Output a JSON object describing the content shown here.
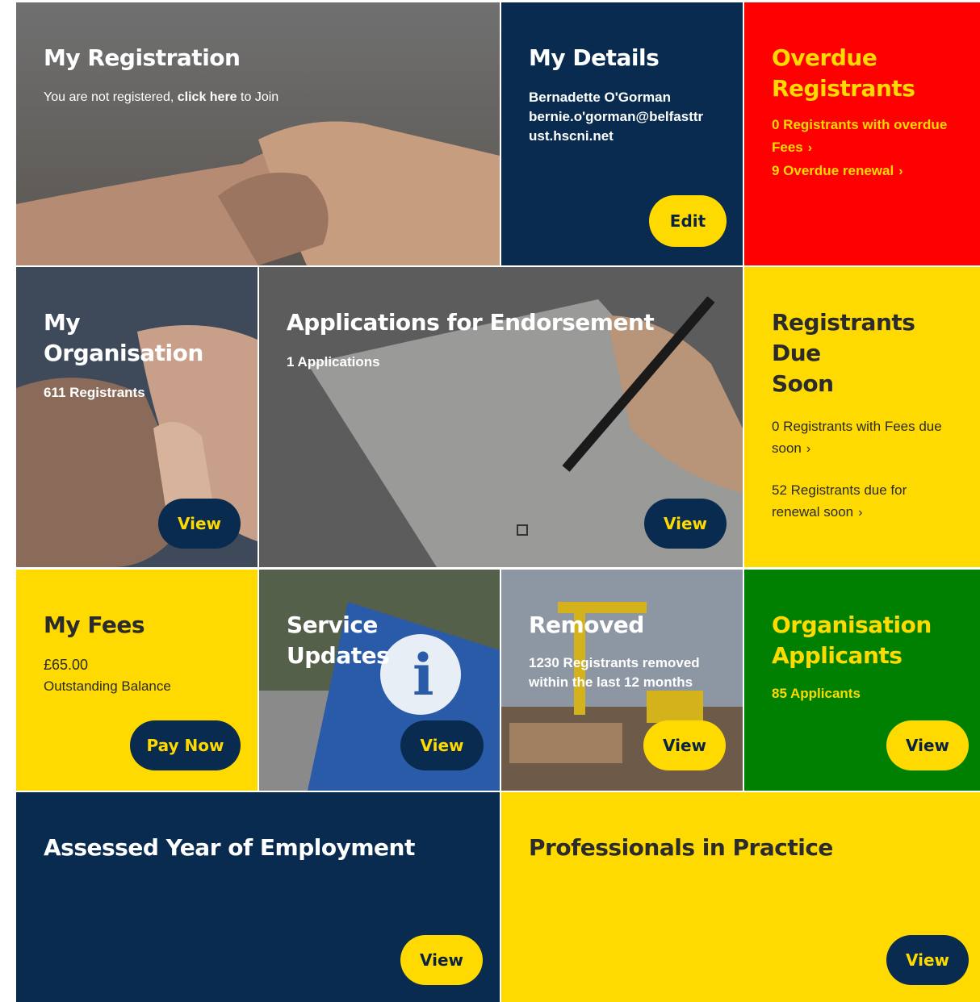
{
  "colors": {
    "navy": "#082b4f",
    "yellow": "#FFDA00",
    "red": "#FF0000",
    "green": "#008000"
  },
  "my_registration": {
    "title": "My Registration",
    "text_prefix": "You are not registered, ",
    "link": "click here",
    "text_suffix": " to Join"
  },
  "my_details": {
    "title": "My Details",
    "name": "Bernadette O'Gorman",
    "email_line1": "bernie.o'gorman@belfasttr",
    "email_line2": "ust.hscni.net",
    "button": "Edit"
  },
  "overdue": {
    "title_line1": "Overdue",
    "title_line2": "Registrants",
    "fees_line1": "0 Registrants with overdue",
    "fees_line2": "Fees",
    "renewal": "9 Overdue renewal"
  },
  "my_organisation": {
    "title": "My Organisation",
    "count": "611 Registrants",
    "button": "View"
  },
  "endorsement": {
    "title": "Applications for Endorsement",
    "count": "1 Applications",
    "button": "View"
  },
  "due_soon": {
    "title_line1": "Registrants Due",
    "title_line2": "Soon",
    "fees_line1": "0 Registrants with Fees due",
    "fees_line2": "soon",
    "renewal_line1": "52 Registrants due for",
    "renewal_line2": "renewal soon"
  },
  "my_fees": {
    "title": "My Fees",
    "amount": "£65.00",
    "label": "Outstanding Balance",
    "button": "Pay Now"
  },
  "service_updates": {
    "title": "Service Updates",
    "button": "View"
  },
  "removed": {
    "title": "Removed",
    "text_line1": "1230 Registrants removed",
    "text_line2": "within the last 12 months",
    "button": "View"
  },
  "org_applicants": {
    "title_line1": "Organisation",
    "title_line2": "Applicants",
    "count": "85 Applicants",
    "button": "View"
  },
  "assessed_year": {
    "title": "Assessed Year of Employment",
    "button": "View"
  },
  "professionals": {
    "title": "Professionals in Practice",
    "button": "View"
  },
  "icons": {
    "chevron": "›"
  }
}
